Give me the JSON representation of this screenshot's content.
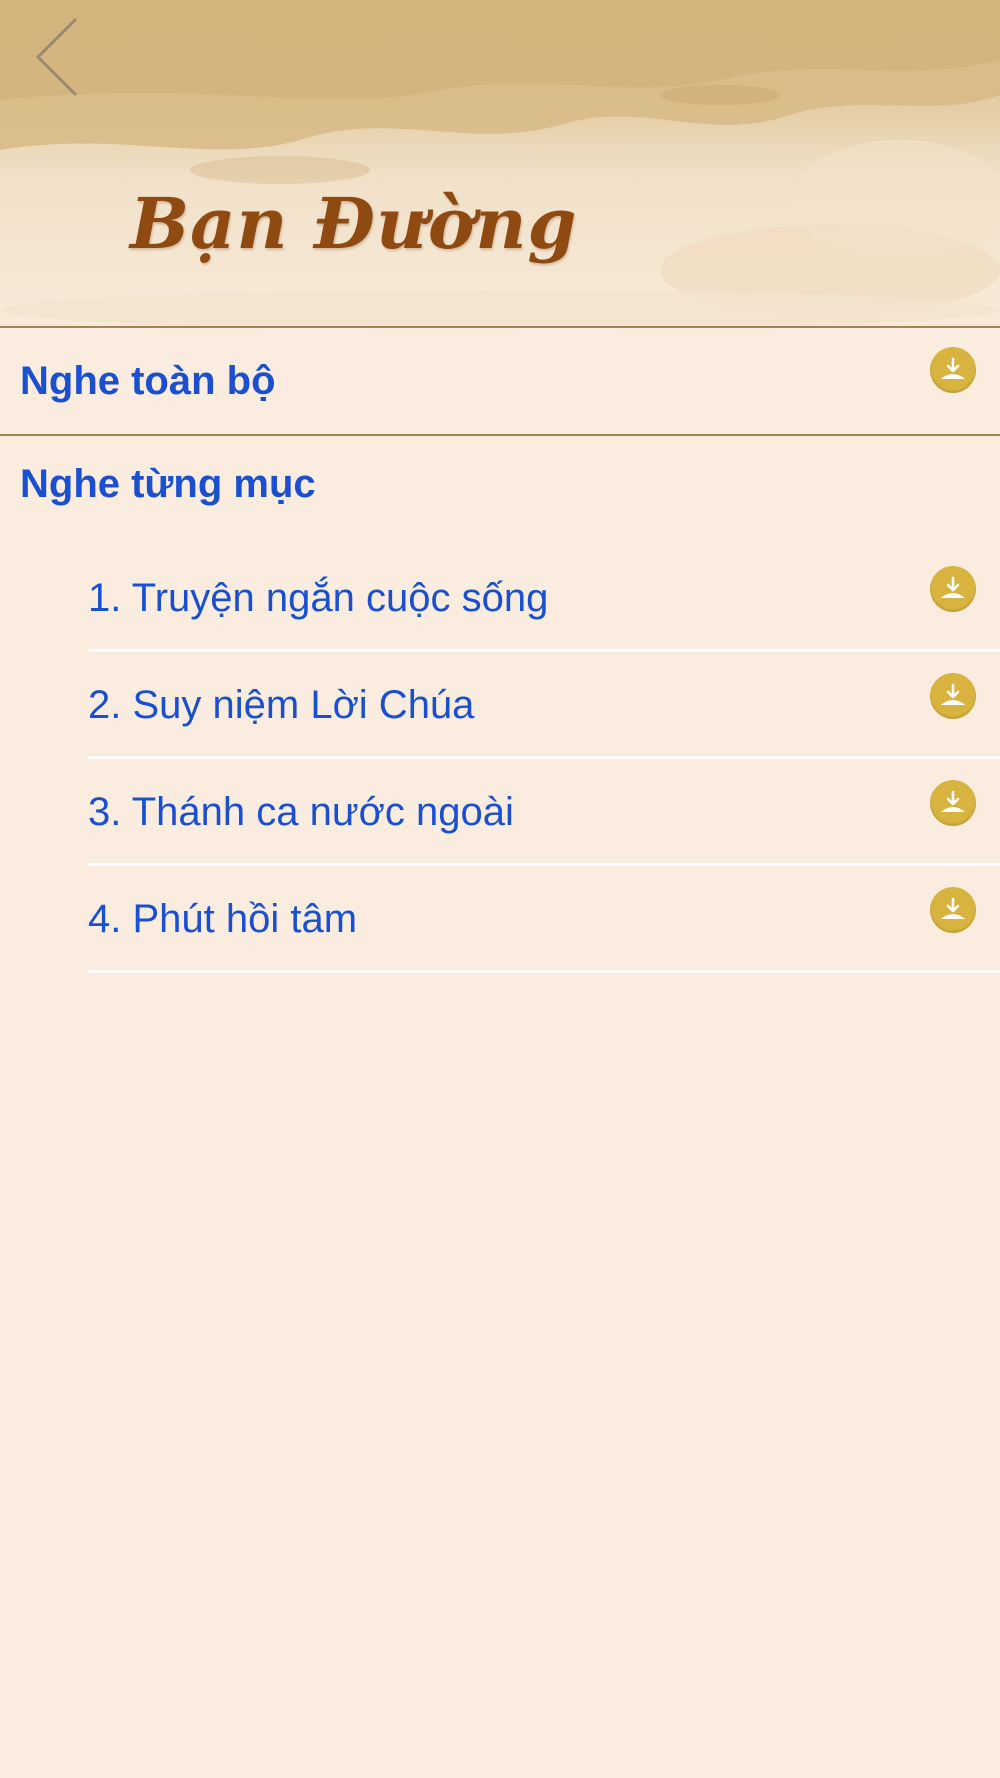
{
  "header": {
    "title": "Bạn Đường",
    "back_icon": "chevron-left-icon"
  },
  "listen_all": {
    "label": "Nghe toàn bộ",
    "icon": "download-icon"
  },
  "section": {
    "label": "Nghe từng mục"
  },
  "items": [
    {
      "label": "1. Truyện ngắn cuộc sống",
      "icon": "download-icon"
    },
    {
      "label": "2. Suy niệm Lời Chúa",
      "icon": "download-icon"
    },
    {
      "label": "3. Thánh ca nước ngoài",
      "icon": "download-icon"
    },
    {
      "label": "4. Phút hồi tâm",
      "icon": "download-icon"
    }
  ],
  "colors": {
    "background": "#faede0",
    "link_blue": "#1a4fd0",
    "title_brown": "#8e4a10",
    "download_gold": "#d9b33f",
    "divider": "#a8824e"
  }
}
